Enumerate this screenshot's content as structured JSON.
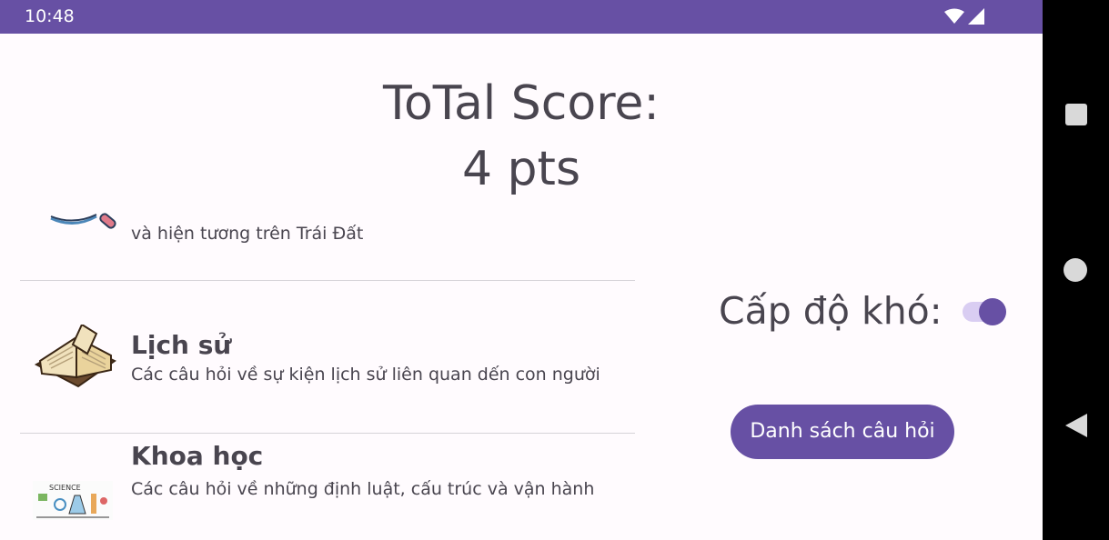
{
  "status_bar": {
    "time": "10:48",
    "icons": [
      "wifi-icon",
      "cellular-signal-icon"
    ]
  },
  "score": {
    "title": "ToTal Score:",
    "value": "4 pts"
  },
  "categories": [
    {
      "title": "",
      "description": "và hiện tương trên Trái Đất",
      "thumbnail": "magnifier-icon"
    },
    {
      "title": "Lịch sử",
      "description": "Các câu hỏi về sự kiện lịch sử liên quan dến con người",
      "thumbnail": "open-book-icon"
    },
    {
      "title": "Khoa học",
      "description": "Các câu hỏi về những định luật, cấu trúc và vận hành",
      "thumbnail": "science-icon"
    }
  ],
  "difficulty": {
    "label": "Cấp độ khó:",
    "enabled": true
  },
  "actions": {
    "question_list_label": "Danh sách câu hỏi"
  },
  "colors": {
    "primary": "#6750a4",
    "background": "#fffbfe",
    "text": "#49454f",
    "switch_track": "#d9cdf2"
  },
  "nav_bar": {
    "icons": [
      "recents-square-icon",
      "home-circle-icon",
      "back-triangle-icon"
    ]
  }
}
